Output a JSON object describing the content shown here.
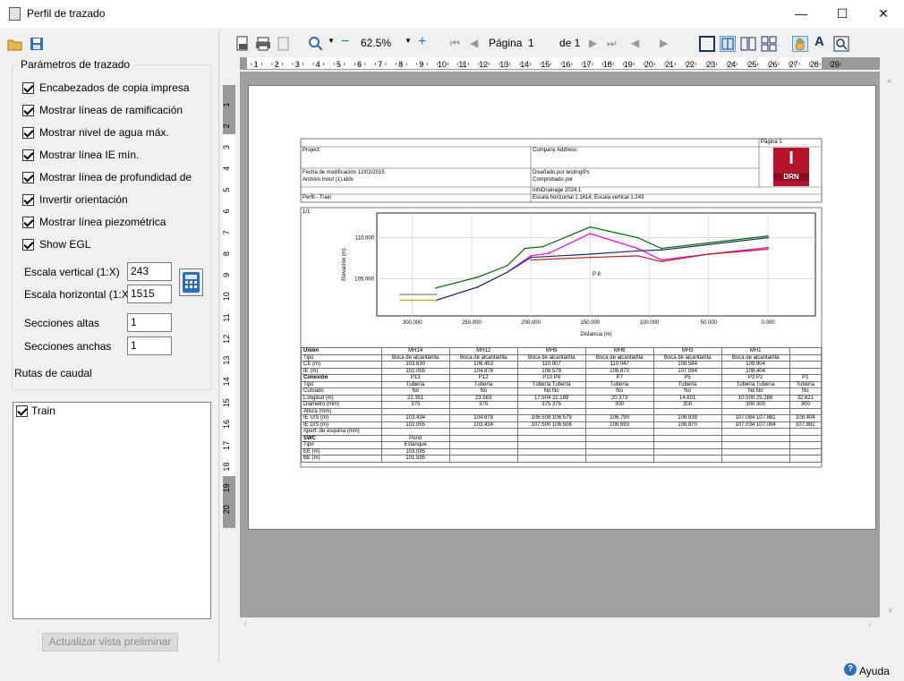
{
  "window": {
    "title": "Perfil de trazado",
    "minimize": "—",
    "maximize": "☐",
    "close": "✕"
  },
  "left": {
    "group_label": "Parámetros de trazado",
    "checkboxes": [
      "Encabezados de copia impresa",
      "Mostrar líneas de ramificación",
      "Mostrar nivel de agua máx.",
      "Mostrar línea IE mín.",
      "Mostrar línea de profundidad de",
      "Invertir orientación",
      "Mostrar línea piezométrica",
      "Show EGL"
    ],
    "vscale_label": "Escala vertical (1:X)",
    "vscale_value": "243",
    "hscale_label": "Escala horizontal (1:X)",
    "hscale_value": "1515",
    "tall_label": "Secciones altas",
    "tall_value": "1",
    "wide_label": "Secciones anchas",
    "wide_value": "1",
    "routes_label": "Rutas de caudal",
    "route_item": "Train",
    "update_button": "Actualizar vista preliminar"
  },
  "toolbar": {
    "zoom": "62.5%",
    "page_label": "Página",
    "page_value": "1",
    "page_of": "de 1"
  },
  "ruler": {
    "h": [
      "1",
      "2",
      "3",
      "4",
      "5",
      "6",
      "7",
      "8",
      "9",
      "10",
      "11",
      "12",
      "13",
      "14",
      "15",
      "16",
      "17",
      "18",
      "19",
      "20",
      "21",
      "22",
      "23",
      "24",
      "25",
      "26",
      "27",
      "28",
      "29"
    ],
    "v": [
      "1",
      "2",
      "3",
      "4",
      "5",
      "6",
      "7",
      "8",
      "9",
      "10",
      "11",
      "12",
      "13",
      "14",
      "15",
      "16",
      "17",
      "18",
      "19",
      "20"
    ]
  },
  "report": {
    "project": "Project:",
    "company": "Company Address:",
    "page": "Página 1",
    "modified": "Fecha de modificación 12/02/2015",
    "file": "Archivo Inout (1).iddx",
    "designed": "Diseñado por testing/Pc",
    "checked": "Comprobado por",
    "version": "InfoDrainage 2024.1",
    "profile": "Perfil - Train",
    "scales": "Escala horizontal 1:1614, Escala vertical 1:243",
    "logo_letter": "I",
    "logo_text": "DRN",
    "chart_id": "1/1",
    "marker": "P 8"
  },
  "chart_data": {
    "type": "line",
    "xlabel": "Distancia (m)",
    "ylabel": "Elevación (m)",
    "xticks": [
      "300.000",
      "250.000",
      "200.000",
      "150.000",
      "100.000",
      "50.000",
      "0.000"
    ],
    "yticks": [
      "110.000",
      "105.000"
    ],
    "xlim": [
      330,
      -40
    ],
    "ylim": [
      100.5,
      113
    ],
    "series": [
      {
        "color": "#006400",
        "x": [
          280,
          245,
          220,
          205,
          190,
          150,
          110,
          90,
          0
        ],
        "y": [
          103.9,
          105.2,
          106.6,
          108.7,
          108.9,
          111.3,
          110.0,
          108.7,
          110.2
        ]
      },
      {
        "color": "#e000e0",
        "x": [
          280,
          245,
          220,
          200,
          185,
          150,
          110,
          90,
          50,
          0
        ],
        "y": [
          102.4,
          104.0,
          105.8,
          107.8,
          108.1,
          110.5,
          108.7,
          107.3,
          108.0,
          108.8
        ]
      },
      {
        "color": "#1c2f66",
        "x": [
          280,
          245,
          220,
          200,
          150,
          110,
          90,
          0
        ],
        "y": [
          102.4,
          104.0,
          105.8,
          107.6,
          108.0,
          108.4,
          108.5,
          110.0
        ]
      },
      {
        "color": "#b22222",
        "x": [
          200,
          150,
          110,
          90,
          50,
          0
        ],
        "y": [
          107.3,
          107.6,
          107.8,
          107.1,
          108.0,
          108.6
        ]
      },
      {
        "color": "#777777",
        "x": [
          310,
          280
        ],
        "y": [
          103.1,
          103.1
        ]
      },
      {
        "color": "#d4a017",
        "x": [
          310,
          280
        ],
        "y": [
          102.4,
          102.4
        ]
      }
    ]
  },
  "table": {
    "rows": [
      [
        "Unión",
        "MH14",
        "MH12",
        "MH9",
        "MH6",
        "MH3",
        "MH1"
      ],
      [
        "Tipo",
        "Boca de alcantarilla",
        "Boca de alcantarilla",
        "Boca de alcantarilla",
        "Boca de alcantarilla",
        "Boca de alcantarilla",
        "Boca de alcantarilla"
      ],
      [
        "CE (m)",
        "103.630",
        "106.453",
        "110.907",
        "110.047",
        "108.584",
        "109.904"
      ],
      [
        "IE (m)",
        "102.055",
        "104.878",
        "106.579",
        "106.870",
        "107.084",
        "108.404"
      ],
      [
        "Conexión",
        "P13",
        "P12",
        "P10 P9",
        "P7",
        "P5",
        "P3 P2",
        "P1"
      ],
      [
        "Tipo",
        "Tubería",
        "Tubería",
        "Tubería Tubería",
        "Tubería",
        "Tubería",
        "Tubería Tubería",
        "Tubería"
      ],
      [
        "Curvado",
        "No",
        "No",
        "No No",
        "No",
        "No",
        "No No",
        "No"
      ],
      [
        "Longitud (m)",
        "22.351",
        "23.563",
        "17.504 22.189",
        "20.373",
        "14.601",
        "10.500 25.266",
        "32.621"
      ],
      [
        "Diámetro (mm)",
        "375",
        "375",
        "375 375",
        "300",
        "300",
        "300 300",
        "300"
      ],
      [
        "Altura (mm)"
      ],
      [
        "IE U/S (m)",
        "103.434",
        "104.878",
        "106.508 106.579",
        "106.790",
        "106.939",
        "107.084 107.881",
        "108.404"
      ],
      [
        "IE D/S (m)",
        "102.055",
        "103.434",
        "107.500 106.508",
        "106.693",
        "106.870",
        "107.034 107.084",
        "107.881"
      ],
      [
        "Apert. de esquina (mm)"
      ],
      [
        "SWC",
        "Pond"
      ],
      [
        "Tipo",
        "Estanque"
      ],
      [
        "EE (m)",
        "103.095"
      ],
      [
        "BE (m)",
        "101.595"
      ]
    ]
  },
  "footer": {
    "help": "Ayuda"
  }
}
